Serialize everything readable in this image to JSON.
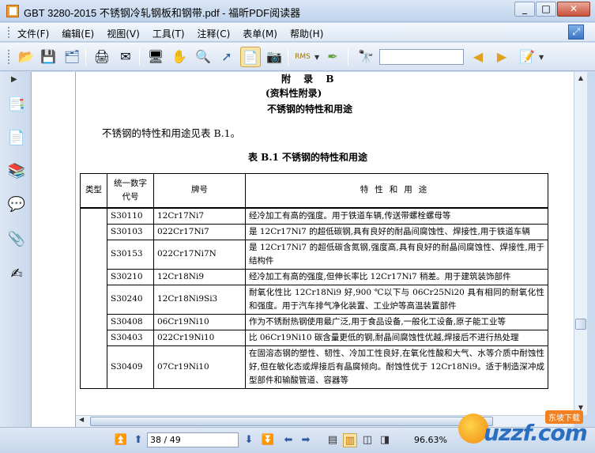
{
  "window": {
    "title": "GBT 3280-2015 不锈钢冷轧钢板和钢带.pdf - 福昕PDF阅读器",
    "minimize": "_",
    "maximize": "□",
    "close": "✕"
  },
  "menu": [
    "文件(F)",
    "编辑(E)",
    "视图(V)",
    "工具(T)",
    "注释(C)",
    "表单(M)",
    "帮助(H)"
  ],
  "toolbar": {
    "icons": [
      "open-icon",
      "save-icon",
      "save-all-icon",
      "print-icon",
      "email-icon",
      "fullscreen-icon",
      "hand-icon",
      "zoom-icon",
      "select-icon",
      "select-text-icon",
      "snapshot-icon",
      "rms-icon",
      "sign-icon",
      "find-icon",
      "prev-result-icon",
      "next-result-icon",
      "highlight-icon"
    ],
    "search_value": ""
  },
  "document": {
    "appendix": "附 录 B",
    "appendix_note": "(资料性附录)",
    "appendix_title": "不锈钢的特性和用途",
    "intro": "不锈钢的特性和用途见表 B.1。",
    "table_caption": "表 B.1  不锈钢的特性和用途",
    "table": {
      "headers": {
        "type": "类型",
        "code": "统一数字代号",
        "grade": "牌号",
        "usage": "特性和用途"
      },
      "rows": [
        {
          "code": "S30110",
          "grade": "12Cr17Ni7",
          "usage": "经冷加工有高的强度。用于铁道车辆,传送带螺栓螺母等"
        },
        {
          "code": "S30103",
          "grade": "022Cr17Ni7",
          "usage": "是 12Cr17Ni7 的超低碳钢,具有良好的耐晶间腐蚀性、焊接性,用于铁道车辆"
        },
        {
          "code": "S30153",
          "grade": "022Cr17Ni7N",
          "usage": "是 12Cr17Ni7 的超低碳含氮钢,强度高,具有良好的耐晶间腐蚀性、焊接性,用于结构件"
        },
        {
          "code": "S30210",
          "grade": "12Cr18Ni9",
          "usage": "经冷加工有高的强度,但伸长率比 12Cr17Ni7 稍差。用于建筑装饰部件"
        },
        {
          "code": "S30240",
          "grade": "12Cr18Ni9Si3",
          "usage": "耐氧化性比 12Cr18Ni9 好,900 ℃以下与 06Cr25Ni20 具有相同的耐氧化性和强度。用于汽车排气净化装置、工业炉等高温装置部件"
        },
        {
          "code": "S30408",
          "grade": "06Cr19Ni10",
          "usage": "作为不锈耐热钢使用最广泛,用于食品设备,一般化工设备,原子能工业等"
        },
        {
          "code": "S30403",
          "grade": "022Cr19Ni10",
          "usage": "比 06Cr19Ni10 碳含量更低的钢,耐晶间腐蚀性优越,焊接后不进行热处理"
        },
        {
          "code": "S30409",
          "grade": "07Cr19Ni10",
          "usage": "在固溶态钢的塑性、韧性、冷加工性良好,在氧化性酸和大气、水等介质中耐蚀性好,但在敏化态或焊接后有晶腐倾向。耐蚀性优于 12Cr18Ni9。适于制造深冲成型部件和输酸管道、容器等"
        }
      ]
    }
  },
  "status": {
    "page": "38 / 49",
    "zoom": "96.63%",
    "watermark": "uzzf.com",
    "watermark_badge": "东坡下载"
  },
  "colors": {
    "accent": "#2b6fc0",
    "titlebar": "#c9dbf0",
    "close": "#c8503a"
  }
}
